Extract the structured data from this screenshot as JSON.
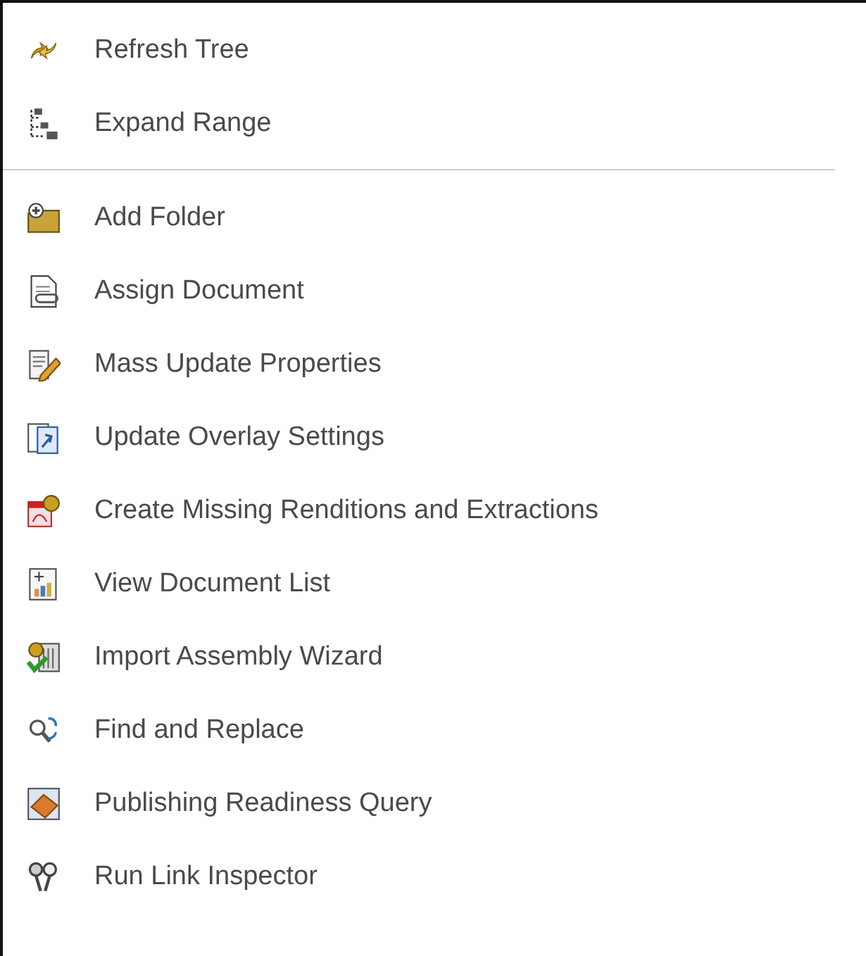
{
  "menu": {
    "sections": [
      {
        "items": [
          {
            "label": "Refresh Tree"
          },
          {
            "label": "Expand Range"
          }
        ]
      },
      {
        "items": [
          {
            "label": "Add Folder"
          },
          {
            "label": "Assign Document"
          },
          {
            "label": "Mass Update Properties"
          },
          {
            "label": "Update Overlay Settings"
          },
          {
            "label": "Create Missing Renditions and Extractions"
          },
          {
            "label": "View Document List"
          },
          {
            "label": "Import Assembly Wizard"
          },
          {
            "label": "Find and Replace"
          },
          {
            "label": "Publishing Readiness Query"
          },
          {
            "label": "Run Link Inspector"
          }
        ]
      }
    ]
  }
}
